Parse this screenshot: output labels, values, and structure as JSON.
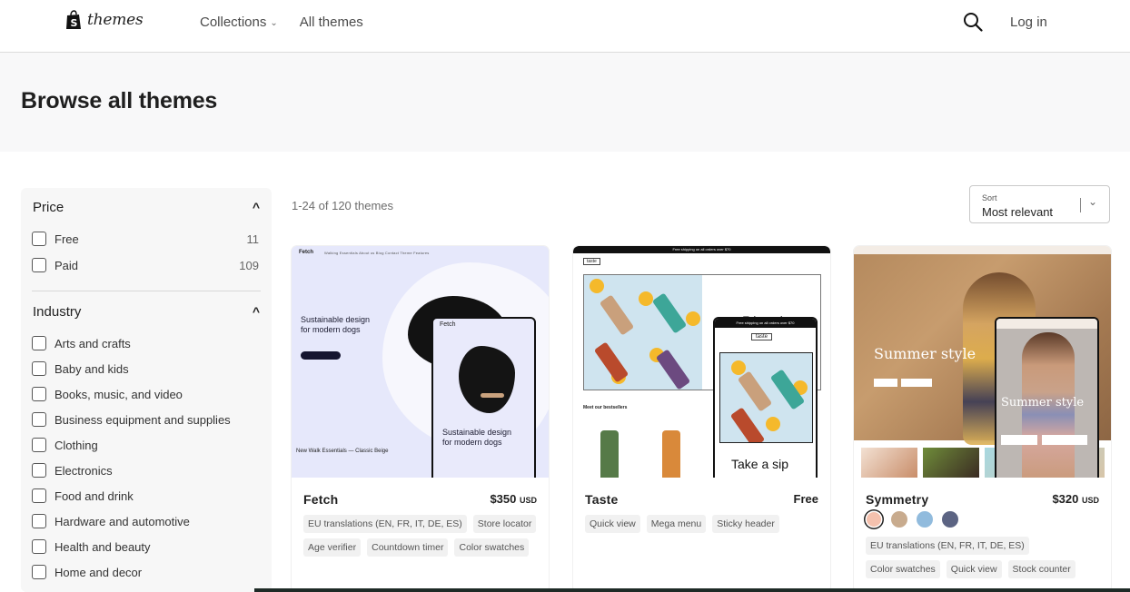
{
  "header": {
    "logo_text": "themes",
    "nav": [
      {
        "label": "Collections",
        "has_dropdown": true
      },
      {
        "label": "All themes",
        "has_dropdown": false
      }
    ],
    "search_icon": "search-icon",
    "login_label": "Log in"
  },
  "hero": {
    "title": "Browse all themes"
  },
  "filters": {
    "price": {
      "title": "Price",
      "expanded": true,
      "options": [
        {
          "label": "Free",
          "count": "11",
          "checked": false
        },
        {
          "label": "Paid",
          "count": "109",
          "checked": false
        }
      ]
    },
    "industry": {
      "title": "Industry",
      "expanded": true,
      "options": [
        {
          "label": "Arts and crafts",
          "checked": false
        },
        {
          "label": "Baby and kids",
          "checked": false
        },
        {
          "label": "Books, music, and video",
          "checked": false
        },
        {
          "label": "Business equipment and supplies",
          "checked": false
        },
        {
          "label": "Clothing",
          "checked": false
        },
        {
          "label": "Electronics",
          "checked": false
        },
        {
          "label": "Food and drink",
          "checked": false
        },
        {
          "label": "Hardware and automotive",
          "checked": false
        },
        {
          "label": "Health and beauty",
          "checked": false
        },
        {
          "label": "Home and decor",
          "checked": false
        }
      ]
    }
  },
  "results": {
    "count_text": "1-24 of 120 themes",
    "sort": {
      "label": "Sort",
      "value": "Most relevant"
    }
  },
  "themes": [
    {
      "name": "Fetch",
      "price": "$350",
      "currency": "USD",
      "preview": {
        "brand": "Fetch",
        "nav_links": "Walking Essentials   About us   Blog   Contact   Theme Features",
        "headline_line1": "Sustainable design",
        "headline_line2": "for modern dogs",
        "caption": "New Walk Essentials — Classic Beige"
      },
      "tags": [
        "EU translations (EN, FR, IT, DE, ES)",
        "Store locator",
        "Age verifier",
        "Countdown timer",
        "Color swatches"
      ]
    },
    {
      "name": "Taste",
      "price": "Free",
      "currency": "",
      "preview": {
        "announcement": "Free shipping on all orders over $70",
        "brand": "taste",
        "headline": "Take a sip",
        "section": "Meet our bestsellers"
      },
      "tags": [
        "Quick view",
        "Mega menu",
        "Sticky header"
      ]
    },
    {
      "name": "Symmetry",
      "price": "$320",
      "currency": "USD",
      "preview": {
        "headline": "Summer style"
      },
      "swatches": [
        {
          "name": "Peach",
          "color": "#f4c1ae",
          "selected": true
        },
        {
          "name": "Tan",
          "color": "#c8ab8e",
          "selected": false
        },
        {
          "name": "Sky blue",
          "color": "#91bbdd",
          "selected": false
        },
        {
          "name": "Slate",
          "color": "#5c6483",
          "selected": false
        }
      ],
      "tags": [
        "EU translations (EN, FR, IT, DE, ES)",
        "Color swatches",
        "Quick view",
        "Stock counter"
      ]
    }
  ]
}
